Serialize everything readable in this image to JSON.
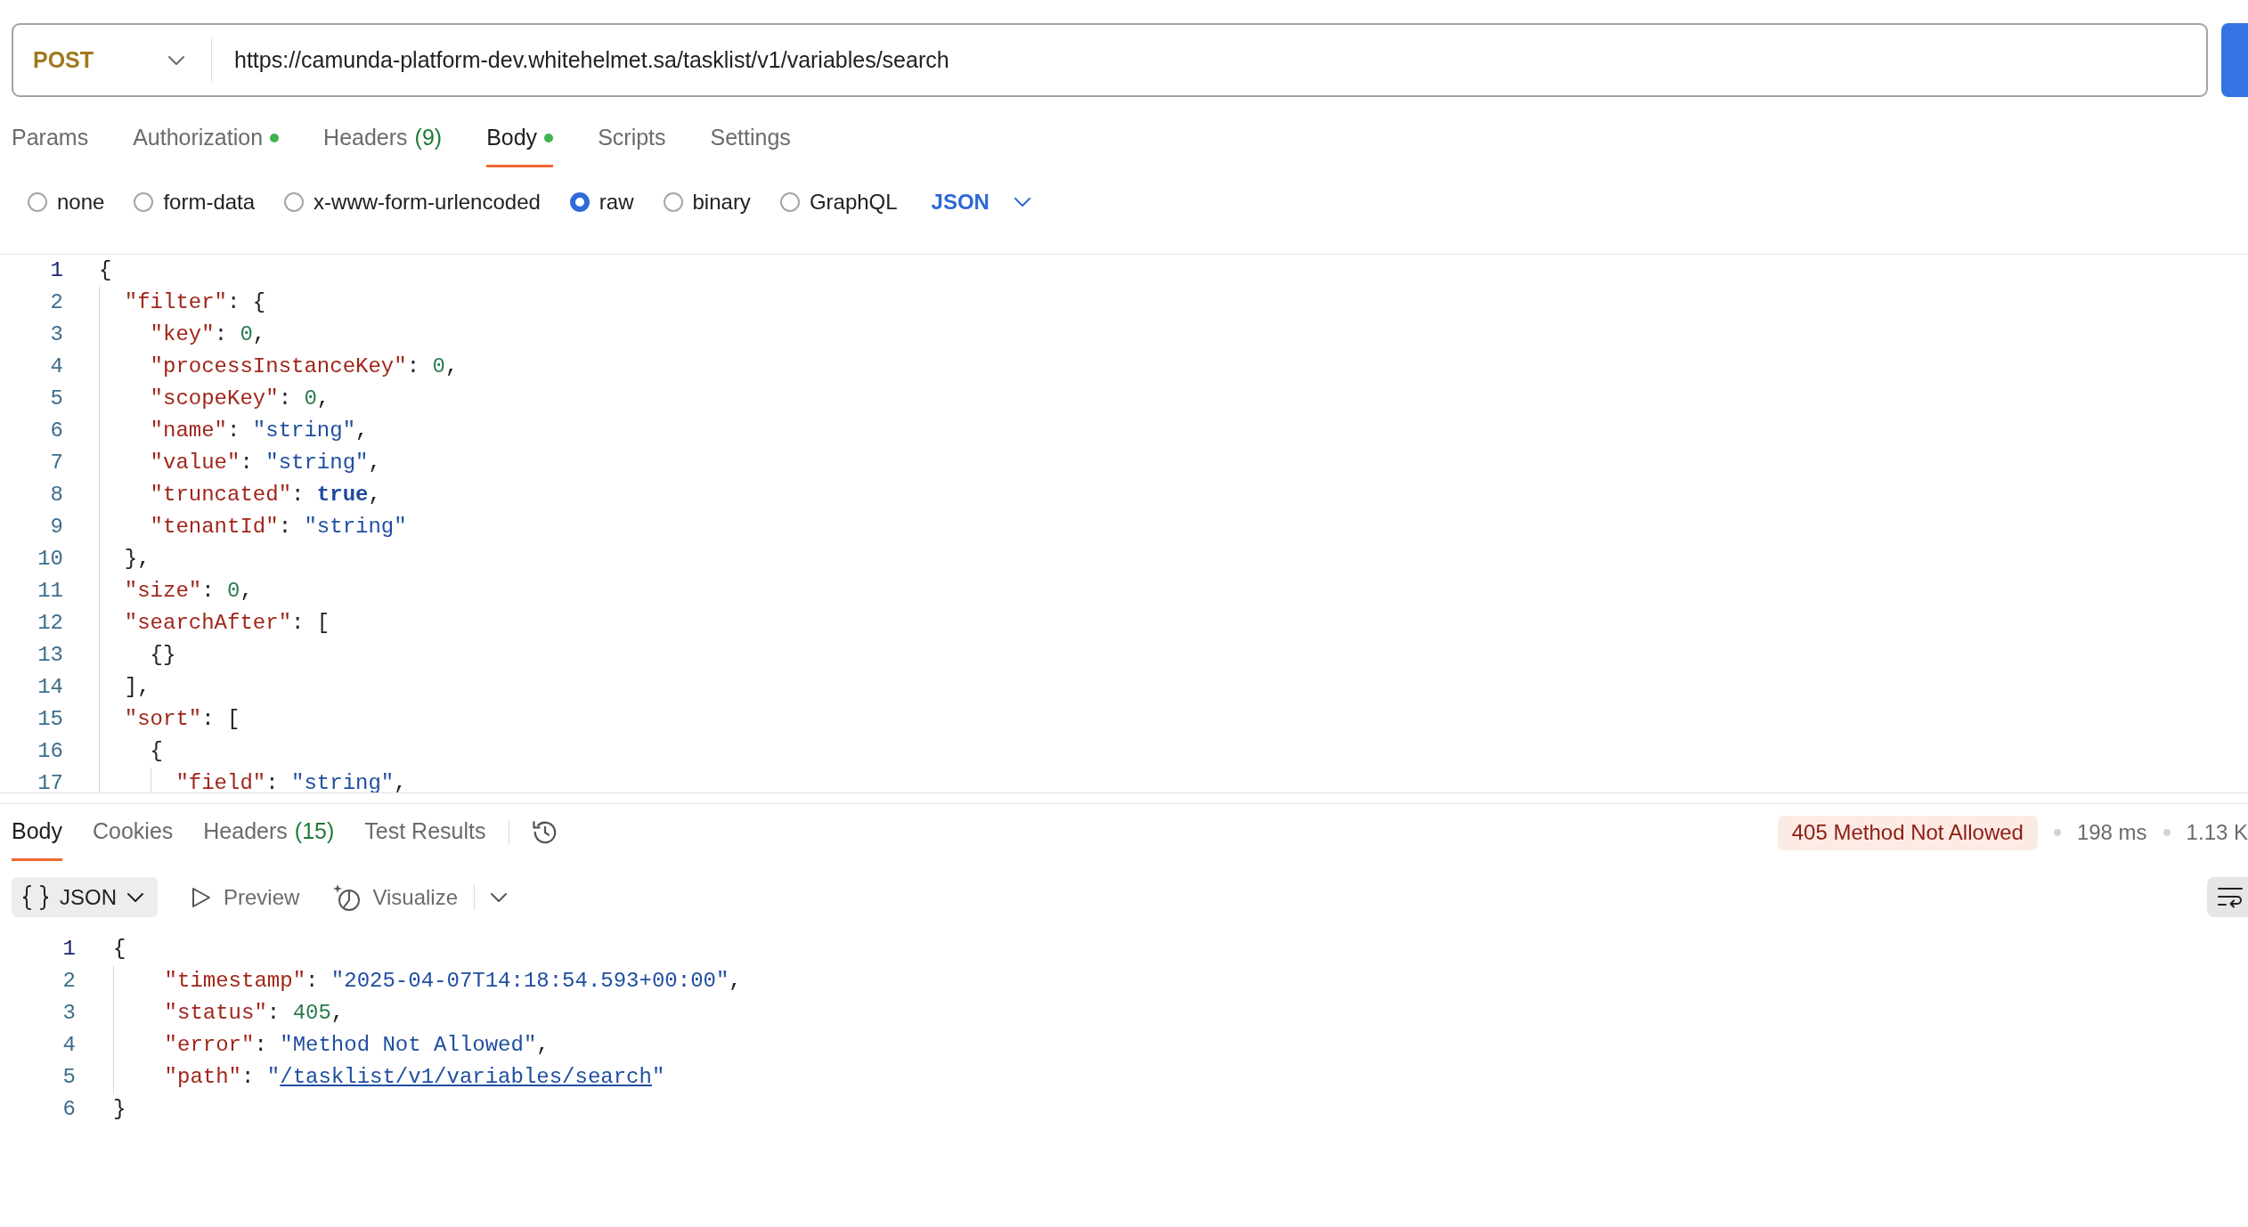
{
  "request_bar": {
    "method": "POST",
    "url": "https://camunda-platform-dev.whitehelmet.sa/tasklist/v1/variables/search"
  },
  "request_tabs": [
    {
      "label": "Params",
      "selected": false,
      "dot": false
    },
    {
      "label": "Authorization",
      "selected": false,
      "dot": true
    },
    {
      "label": "Headers",
      "count": "(9)",
      "selected": false,
      "dot": false
    },
    {
      "label": "Body",
      "selected": true,
      "dot": true
    },
    {
      "label": "Scripts",
      "selected": false,
      "dot": false
    },
    {
      "label": "Settings",
      "selected": false,
      "dot": false
    }
  ],
  "body_types": [
    {
      "label": "none",
      "selected": false
    },
    {
      "label": "form-data",
      "selected": false
    },
    {
      "label": "x-www-form-urlencoded",
      "selected": false
    },
    {
      "label": "raw",
      "selected": true
    },
    {
      "label": "binary",
      "selected": false
    },
    {
      "label": "GraphQL",
      "selected": false
    }
  ],
  "body_format": "JSON",
  "request_body": {
    "lines": [
      {
        "number": "1",
        "current": true,
        "tokens": [
          {
            "kind": "punct",
            "text": "{"
          }
        ]
      },
      {
        "number": "2",
        "current": false,
        "tokens": [
          {
            "kind": "key",
            "text": "  \"filter\""
          },
          {
            "kind": "punct",
            "text": ": {"
          }
        ]
      },
      {
        "number": "3",
        "current": false,
        "tokens": [
          {
            "kind": "key",
            "text": "    \"key\""
          },
          {
            "kind": "punct",
            "text": ": "
          },
          {
            "kind": "number",
            "text": "0"
          },
          {
            "kind": "punct",
            "text": ","
          }
        ]
      },
      {
        "number": "4",
        "current": false,
        "tokens": [
          {
            "kind": "key",
            "text": "    \"processInstanceKey\""
          },
          {
            "kind": "punct",
            "text": ": "
          },
          {
            "kind": "number",
            "text": "0"
          },
          {
            "kind": "punct",
            "text": ","
          }
        ]
      },
      {
        "number": "5",
        "current": false,
        "tokens": [
          {
            "kind": "key",
            "text": "    \"scopeKey\""
          },
          {
            "kind": "punct",
            "text": ": "
          },
          {
            "kind": "number",
            "text": "0"
          },
          {
            "kind": "punct",
            "text": ","
          }
        ]
      },
      {
        "number": "6",
        "current": false,
        "tokens": [
          {
            "kind": "key",
            "text": "    \"name\""
          },
          {
            "kind": "punct",
            "text": ": "
          },
          {
            "kind": "string",
            "text": "\"string\""
          },
          {
            "kind": "punct",
            "text": ","
          }
        ]
      },
      {
        "number": "7",
        "current": false,
        "tokens": [
          {
            "kind": "key",
            "text": "    \"value\""
          },
          {
            "kind": "punct",
            "text": ": "
          },
          {
            "kind": "string",
            "text": "\"string\""
          },
          {
            "kind": "punct",
            "text": ","
          }
        ]
      },
      {
        "number": "8",
        "current": false,
        "tokens": [
          {
            "kind": "key",
            "text": "    \"truncated\""
          },
          {
            "kind": "punct",
            "text": ": "
          },
          {
            "kind": "boolean",
            "text": "true"
          },
          {
            "kind": "punct",
            "text": ","
          }
        ]
      },
      {
        "number": "9",
        "current": false,
        "tokens": [
          {
            "kind": "key",
            "text": "    \"tenantId\""
          },
          {
            "kind": "punct",
            "text": ": "
          },
          {
            "kind": "string",
            "text": "\"string\""
          }
        ]
      },
      {
        "number": "10",
        "current": false,
        "tokens": [
          {
            "kind": "punct",
            "text": "  },"
          }
        ]
      },
      {
        "number": "11",
        "current": false,
        "tokens": [
          {
            "kind": "key",
            "text": "  \"size\""
          },
          {
            "kind": "punct",
            "text": ": "
          },
          {
            "kind": "number",
            "text": "0"
          },
          {
            "kind": "punct",
            "text": ","
          }
        ]
      },
      {
        "number": "12",
        "current": false,
        "tokens": [
          {
            "kind": "key",
            "text": "  \"searchAfter\""
          },
          {
            "kind": "punct",
            "text": ": ["
          }
        ]
      },
      {
        "number": "13",
        "current": false,
        "tokens": [
          {
            "kind": "punct",
            "text": "    {}"
          }
        ]
      },
      {
        "number": "14",
        "current": false,
        "tokens": [
          {
            "kind": "punct",
            "text": "  ],"
          }
        ]
      },
      {
        "number": "15",
        "current": false,
        "tokens": [
          {
            "kind": "key",
            "text": "  \"sort\""
          },
          {
            "kind": "punct",
            "text": ": ["
          }
        ]
      },
      {
        "number": "16",
        "current": false,
        "tokens": [
          {
            "kind": "punct",
            "text": "    {"
          }
        ]
      },
      {
        "number": "17",
        "current": false,
        "tokens": [
          {
            "kind": "key",
            "text": "      \"field\""
          },
          {
            "kind": "punct",
            "text": ": "
          },
          {
            "kind": "string",
            "text": "\"string\""
          },
          {
            "kind": "punct",
            "text": ","
          }
        ]
      }
    ]
  },
  "response_tabs": [
    {
      "label": "Body",
      "selected": true
    },
    {
      "label": "Cookies",
      "selected": false
    },
    {
      "label": "Headers",
      "count": "(15)",
      "selected": false
    },
    {
      "label": "Test Results",
      "selected": false
    }
  ],
  "response_status": {
    "kind": "error",
    "status": "405 Method Not Allowed",
    "time": "198 ms",
    "size": "1.13 K"
  },
  "response_toolbar": {
    "format": "JSON",
    "views": [
      {
        "kind": "preview",
        "label": "Preview"
      },
      {
        "kind": "visualize",
        "label": "Visualize"
      }
    ]
  },
  "response_body": {
    "lines": [
      {
        "number": "1",
        "current": true,
        "tokens": [
          {
            "kind": "punct",
            "text": "{"
          }
        ]
      },
      {
        "number": "2",
        "current": false,
        "tokens": [
          {
            "kind": "key",
            "text": "    \"timestamp\""
          },
          {
            "kind": "punct",
            "text": ": "
          },
          {
            "kind": "string",
            "text": "\"2025-04-07T14:18:54.593+00:00\""
          },
          {
            "kind": "punct",
            "text": ","
          }
        ]
      },
      {
        "number": "3",
        "current": false,
        "tokens": [
          {
            "kind": "key",
            "text": "    \"status\""
          },
          {
            "kind": "punct",
            "text": ": "
          },
          {
            "kind": "number",
            "text": "405"
          },
          {
            "kind": "punct",
            "text": ","
          }
        ]
      },
      {
        "number": "4",
        "current": false,
        "tokens": [
          {
            "kind": "key",
            "text": "    \"error\""
          },
          {
            "kind": "punct",
            "text": ": "
          },
          {
            "kind": "string",
            "text": "\"Method Not Allowed\""
          },
          {
            "kind": "punct",
            "text": ","
          }
        ]
      },
      {
        "number": "5",
        "current": false,
        "tokens": [
          {
            "kind": "key",
            "text": "    \"path\""
          },
          {
            "kind": "punct",
            "text": ": "
          },
          {
            "kind": "string",
            "text": "\""
          },
          {
            "kind": "link",
            "text": "/tasklist/v1/variables/search"
          },
          {
            "kind": "string",
            "text": "\""
          }
        ]
      },
      {
        "number": "6",
        "current": false,
        "tokens": [
          {
            "kind": "punct",
            "text": "}"
          }
        ]
      }
    ]
  }
}
